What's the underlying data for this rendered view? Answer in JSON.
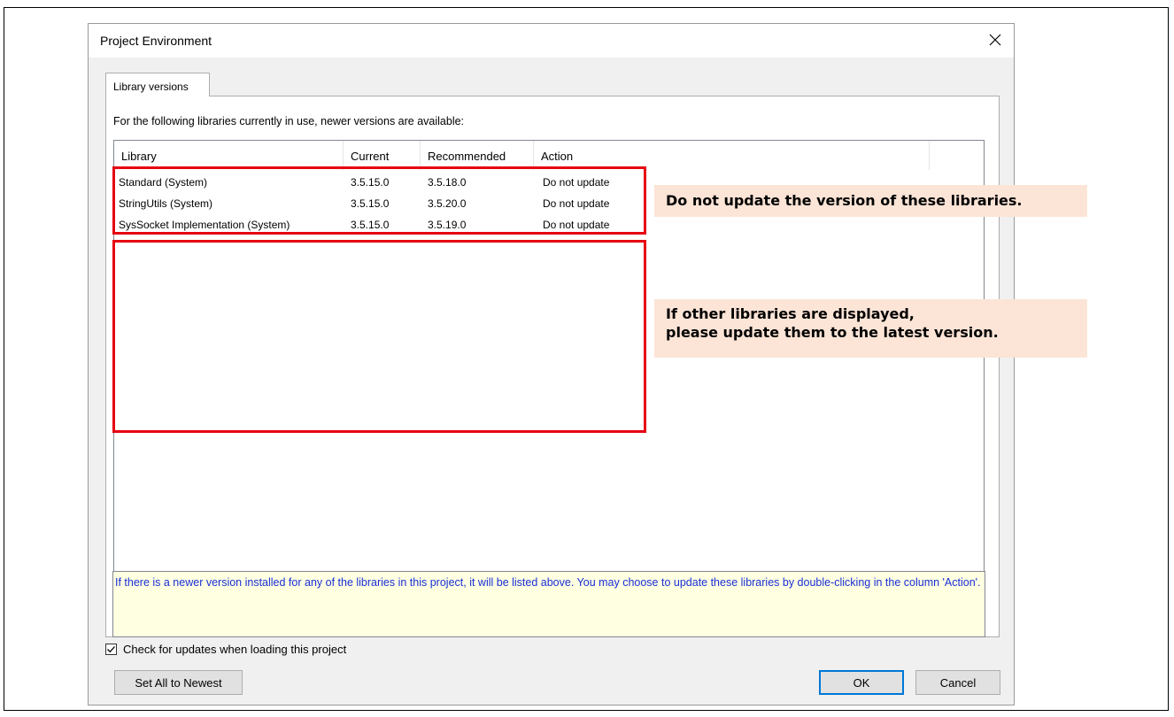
{
  "dialog": {
    "title": "Project Environment",
    "close_glyph": "✕",
    "tab_label": "Library versions",
    "description": "For the following libraries currently in use, newer versions are available:",
    "columns": [
      "Library",
      "Current",
      "Recommended",
      "Action"
    ],
    "rows": [
      {
        "library": "Standard (System)",
        "current": "3.5.15.0",
        "recommended": "3.5.18.0",
        "action": "Do not update"
      },
      {
        "library": "StringUtils (System)",
        "current": "3.5.15.0",
        "recommended": "3.5.20.0",
        "action": "Do not update"
      },
      {
        "library": "SysSocket Implementation (System)",
        "current": "3.5.15.0",
        "recommended": "3.5.19.0",
        "action": "Do not update"
      }
    ],
    "help_text": "If there is a newer version installed for any of the libraries in this project, it will be listed above. You may choose to update these libraries by double-clicking in the column 'Action'.",
    "checkbox_label": "Check for updates when loading this project",
    "checkbox_checked": true,
    "set_all_button": "Set All to Newest",
    "ok_button": "OK",
    "cancel_button": "Cancel"
  },
  "annotations": {
    "callout_1": "Do not update the version of these libraries.",
    "callout_2_line1": "If other libraries are displayed,",
    "callout_2_line2": "please update them to the latest version.",
    "highlight_color": "#e60012",
    "callout_background": "#fce4d6"
  },
  "colors": {
    "help_text": "#1a2fd6",
    "help_background": "#ffffe1",
    "default_button_border": "#0078d7"
  }
}
